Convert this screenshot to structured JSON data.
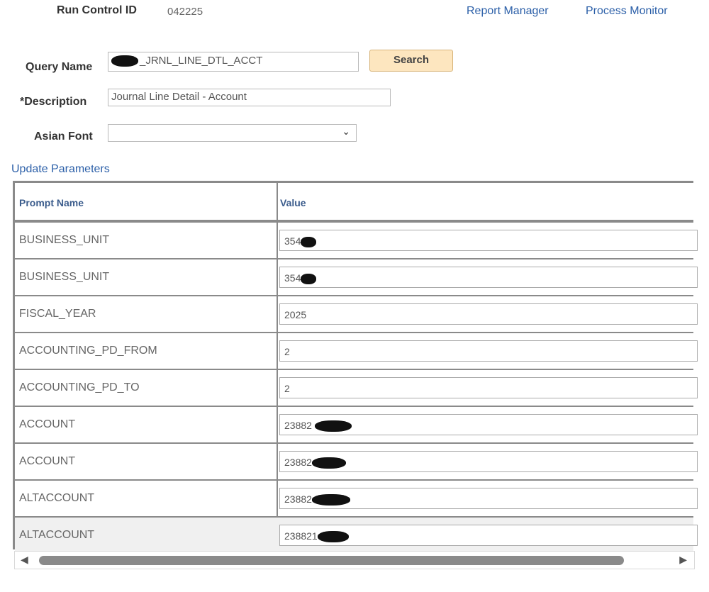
{
  "header": {
    "run_control_label": "Run Control ID",
    "run_control_value": "042225",
    "report_manager": "Report Manager",
    "process_monitor": "Process Monitor"
  },
  "form": {
    "query_name_label": "Query Name",
    "query_name_value": "_JRNL_LINE_DTL_ACCT",
    "search_button": "Search",
    "description_label": "*Description",
    "description_value": "Journal Line Detail - Account",
    "asian_font_label": "Asian Font",
    "asian_font_value": "",
    "update_parameters": "Update Parameters"
  },
  "grid": {
    "headers": [
      "Prompt Name",
      "Value"
    ],
    "rows": [
      {
        "prompt": "BUSINESS_UNIT",
        "value": "354"
      },
      {
        "prompt": "BUSINESS_UNIT",
        "value": "354"
      },
      {
        "prompt": "FISCAL_YEAR",
        "value": "2025"
      },
      {
        "prompt": "ACCOUNTING_PD_FROM",
        "value": "2"
      },
      {
        "prompt": "ACCOUNTING_PD_TO",
        "value": "2"
      },
      {
        "prompt": "ACCOUNT",
        "value": "23882"
      },
      {
        "prompt": "ACCOUNT",
        "value": "23882"
      },
      {
        "prompt": "ALTACCOUNT",
        "value": "23882"
      },
      {
        "prompt": "ALTACCOUNT",
        "value": "238821"
      }
    ],
    "redacted_rows": [
      0,
      1,
      5,
      6,
      7,
      8
    ]
  },
  "icons": {
    "dropdown": "chevron-down-icon",
    "scroll_left": "scroll-left-icon",
    "scroll_right": "scroll-right-icon"
  }
}
